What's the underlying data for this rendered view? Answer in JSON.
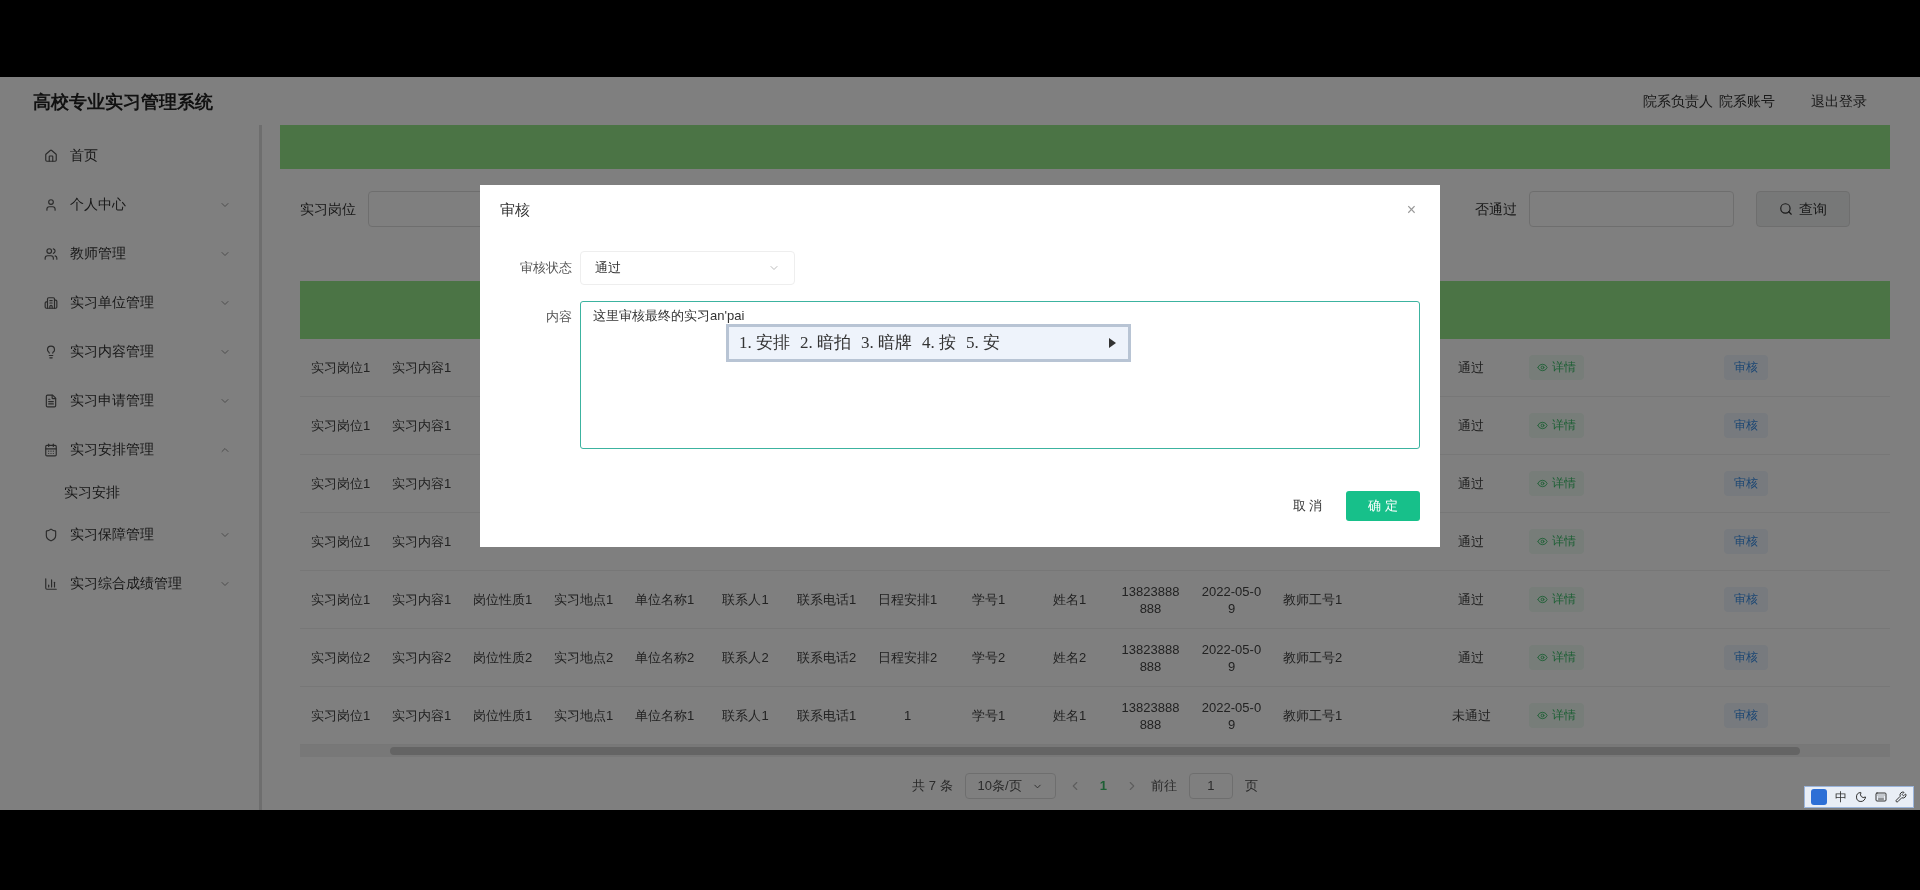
{
  "header": {
    "title": "高校专业实习管理系统",
    "user_links": [
      "院系负责人",
      "院系账号"
    ],
    "logout": "退出登录"
  },
  "sidebar": {
    "items": [
      {
        "label": "首页",
        "kind": "link"
      },
      {
        "label": "个人中心",
        "kind": "menu",
        "expanded": false
      },
      {
        "label": "教师管理",
        "kind": "menu",
        "expanded": false
      },
      {
        "label": "实习单位管理",
        "kind": "menu",
        "expanded": false
      },
      {
        "label": "实习内容管理",
        "kind": "menu",
        "expanded": false
      },
      {
        "label": "实习申请管理",
        "kind": "menu",
        "expanded": false
      },
      {
        "label": "实习安排管理",
        "kind": "menu",
        "expanded": true,
        "children": [
          {
            "label": "实习安排"
          }
        ]
      },
      {
        "label": "实习保障管理",
        "kind": "menu",
        "expanded": false
      },
      {
        "label": "实习综合成绩管理",
        "kind": "menu",
        "expanded": false
      }
    ]
  },
  "search": {
    "fields": [
      {
        "label": "实习岗位"
      },
      {
        "label": "否通过"
      }
    ],
    "button": "查询"
  },
  "table": {
    "rows": [
      {
        "cells": [
          "实习岗位1",
          "实习内容1"
        ],
        "status": "通过",
        "detail": "详情",
        "action": "审核"
      },
      {
        "cells": [
          "实习岗位1",
          "实习内容1"
        ],
        "status": "通过",
        "detail": "详情",
        "action": "审核"
      },
      {
        "cells": [
          "实习岗位1",
          "实习内容1"
        ],
        "status": "通过",
        "detail": "详情",
        "action": "审核"
      },
      {
        "cells": [
          "实习岗位1",
          "实习内容1"
        ],
        "status": "通过",
        "detail": "详情",
        "action": "审核"
      },
      {
        "cells": [
          "实习岗位1",
          "实习内容1",
          "岗位性质1",
          "实习地点1",
          "单位名称1",
          "联系人1",
          "联系电话1",
          "日程安排1",
          "学号1",
          "姓名1",
          "13823888888",
          "2022-05-09",
          "教师工号1"
        ],
        "status": "通过",
        "detail": "详情",
        "action": "审核"
      },
      {
        "cells": [
          "实习岗位2",
          "实习内容2",
          "岗位性质2",
          "实习地点2",
          "单位名称2",
          "联系人2",
          "联系电话2",
          "日程安排2",
          "学号2",
          "姓名2",
          "13823888888",
          "2022-05-09",
          "教师工号2"
        ],
        "status": "通过",
        "detail": "详情",
        "action": "审核"
      },
      {
        "cells": [
          "实习岗位1",
          "实习内容1",
          "岗位性质1",
          "实习地点1",
          "单位名称1",
          "联系人1",
          "联系电话1",
          "1",
          "学号1",
          "姓名1",
          "13823888888",
          "2022-05-09",
          "教师工号1"
        ],
        "status": "未通过",
        "detail": "详情",
        "action": "审核"
      }
    ]
  },
  "pagination": {
    "total": "共 7 条",
    "page_size": "10条/页",
    "pages": [
      {
        "label": "1",
        "selected": true
      }
    ],
    "goto_label": "前往",
    "goto_value": "1",
    "page_suffix": "页"
  },
  "dialog": {
    "title": "审核",
    "close": "×",
    "status_label": "审核状态",
    "status_value": "通过",
    "content_label": "内容",
    "content_value": "这里审核最终的实习an'pai",
    "ime": {
      "candidates": [
        "1. 安排",
        "2. 暗拍",
        "3. 暗牌",
        "4. 按",
        "5. 安"
      ]
    },
    "buttons": [
      {
        "label": "取 消",
        "kind": "default"
      },
      {
        "label": "确 定",
        "kind": "primary"
      }
    ]
  },
  "ime_toolbar": {
    "mode": "中"
  }
}
